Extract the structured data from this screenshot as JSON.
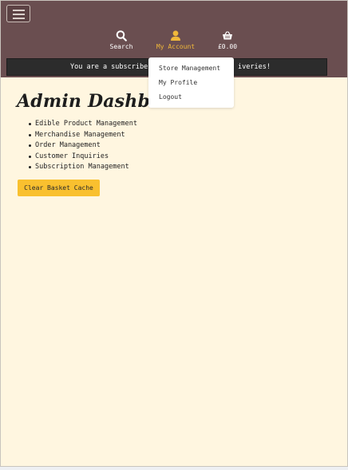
{
  "nav": {
    "search_label": "Search",
    "account_label": "My Account",
    "basket_label": "£0.00"
  },
  "banner": {
    "text_left": "You are a subscriber",
    "text_right": "iveries!"
  },
  "account_menu": {
    "items": [
      "Store Management",
      "My Profile",
      "Logout"
    ]
  },
  "main": {
    "title": "Admin Dashboar",
    "links": [
      "Edible Product Management",
      "Merchandise Management",
      "Order Management",
      "Customer Inquiries",
      "Subscription Management"
    ],
    "clear_button": "Clear Basket Cache"
  },
  "colors": {
    "header_bg": "#6a4e50",
    "page_bg": "#fff6e0",
    "accent": "#f0b83a",
    "button_bg": "#f9c02f",
    "banner_bg": "#2c2c2c"
  },
  "icons": [
    "menu-icon",
    "search-icon",
    "user-icon",
    "basket-icon"
  ]
}
